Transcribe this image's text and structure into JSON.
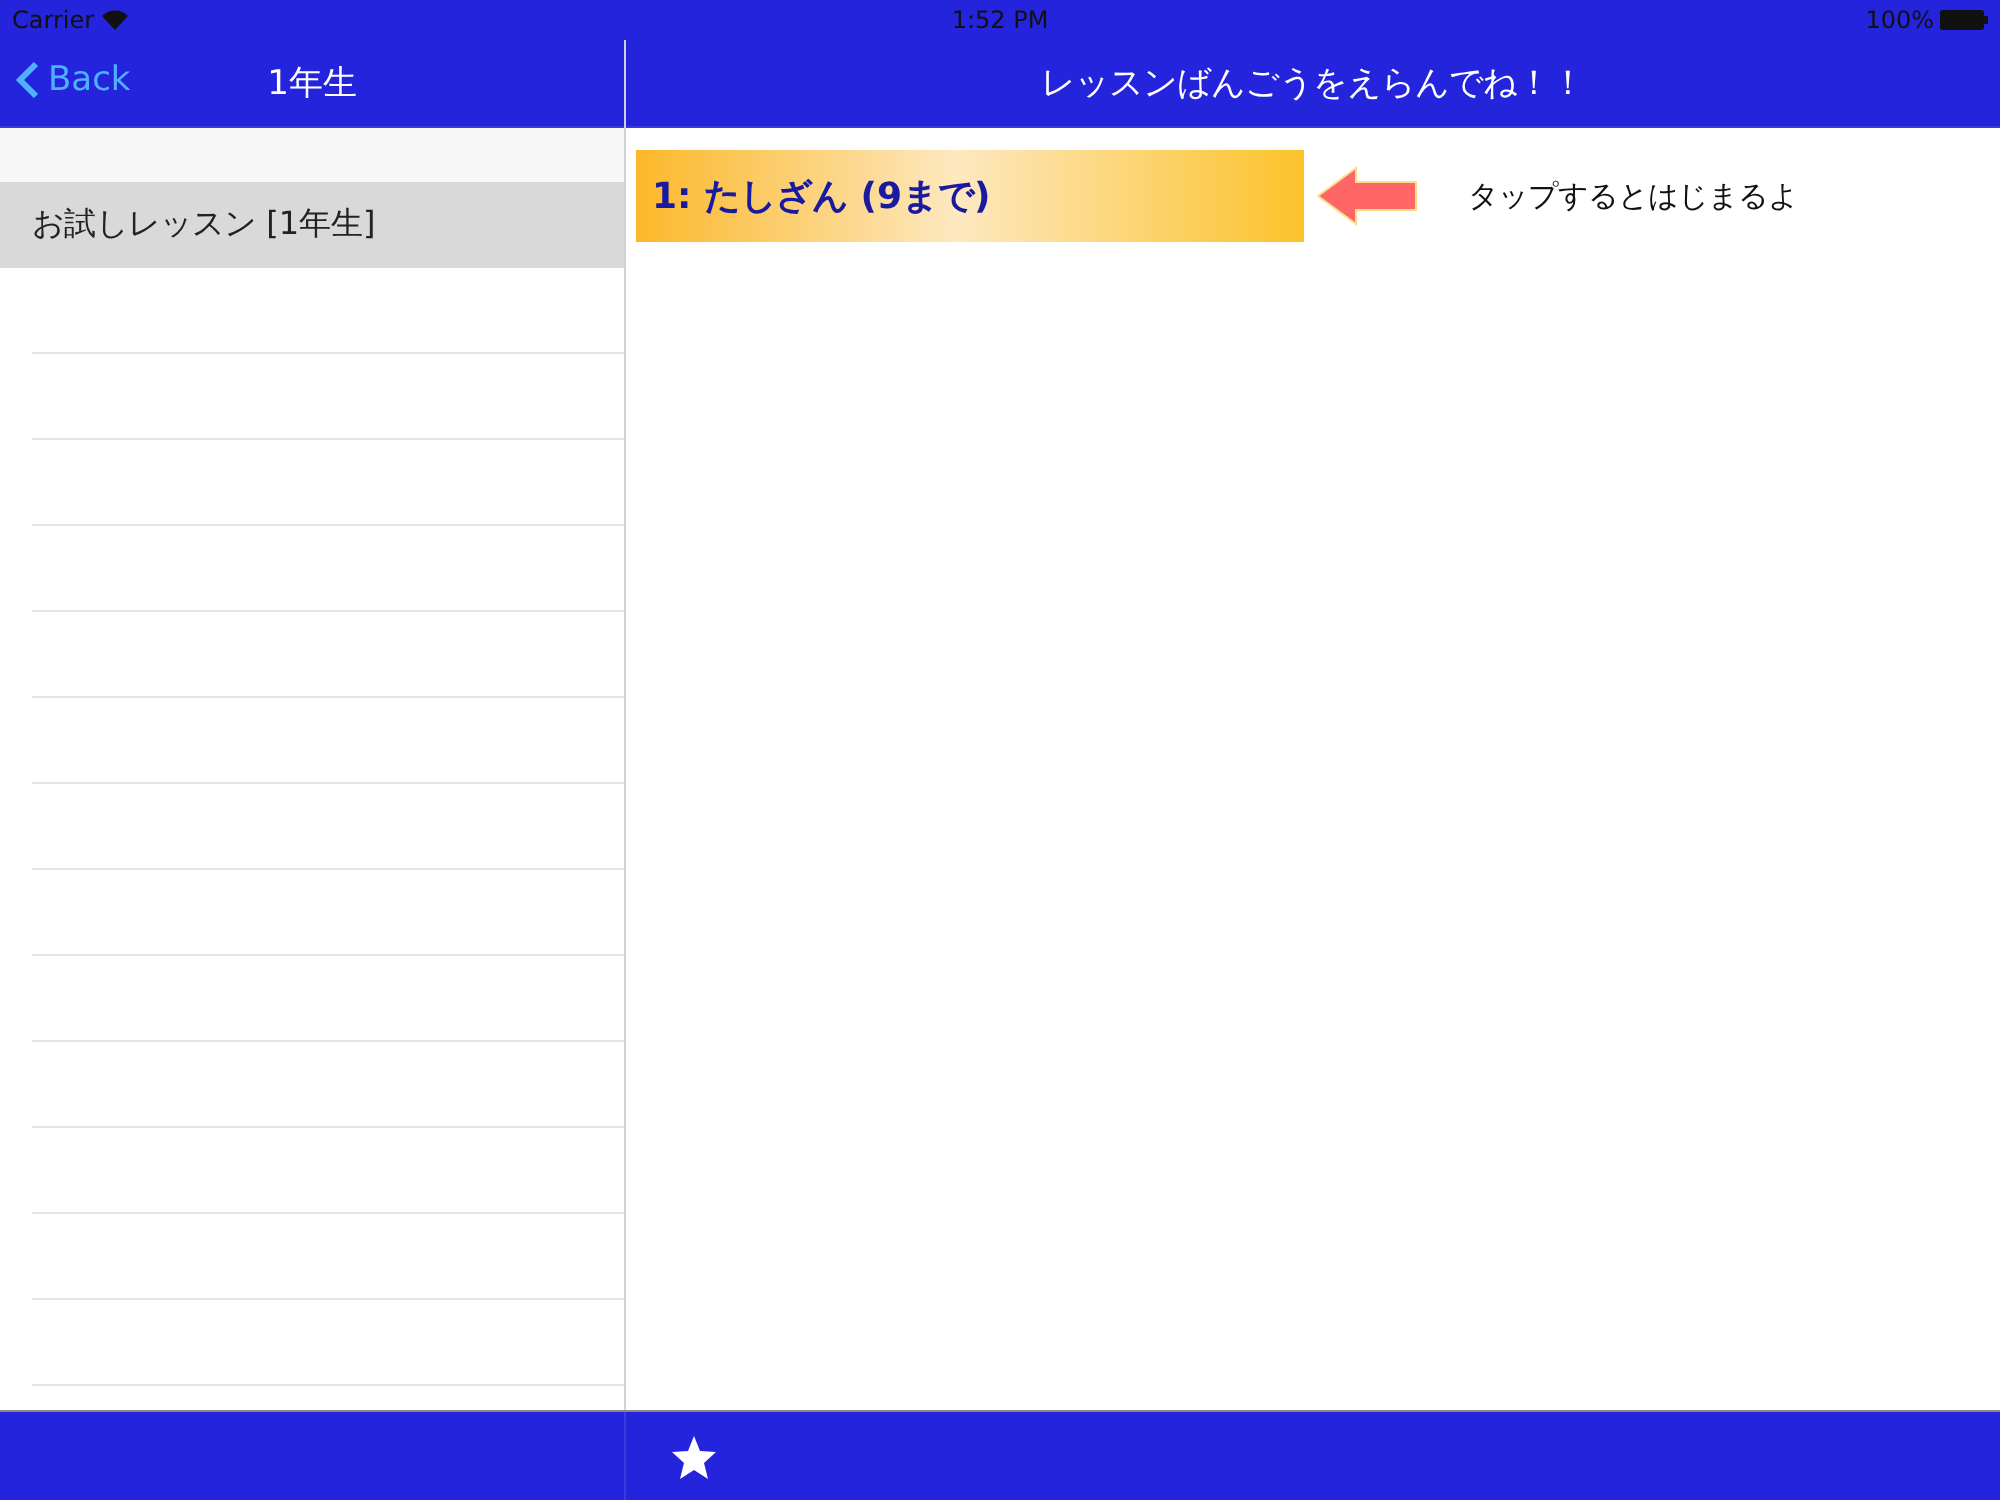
{
  "status_bar": {
    "carrier": "Carrier",
    "time": "1:52 PM",
    "battery": "100%"
  },
  "sidebar": {
    "back": "Back",
    "title": "1年生",
    "items": [
      {
        "label": "お試しレッスン [1年生]",
        "selected": true
      }
    ]
  },
  "main": {
    "title": "レッスンばんごうをえらんでね！！",
    "lessons": [
      {
        "label": "1: たしざん (9まで)"
      }
    ],
    "hint": "タップするとはじまるよ"
  }
}
